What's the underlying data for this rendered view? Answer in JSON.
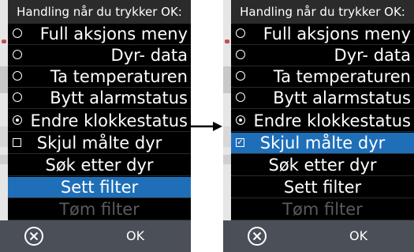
{
  "screens": [
    {
      "header": "Handling når du trykker OK:",
      "items": [
        {
          "label": "Full aksjons meny",
          "control": "radio",
          "checked": false
        },
        {
          "label": "Dyr- data",
          "control": "radio",
          "checked": false
        },
        {
          "label": "Ta temperaturen",
          "control": "radio",
          "checked": false
        },
        {
          "label": "Bytt alarmstatus",
          "control": "radio",
          "checked": false
        },
        {
          "label": "Endre klokkestatus",
          "control": "radio",
          "checked": true
        },
        {
          "label": "Skjul målte dyr",
          "control": "checkbox",
          "checked": false
        },
        {
          "label": "Søk etter dyr",
          "control": "none"
        },
        {
          "label": "Sett filter",
          "control": "none",
          "selected": true
        },
        {
          "label": "Tøm filter",
          "control": "none",
          "disabled": true
        }
      ],
      "footer": {
        "cancel_icon": "cancel-circle-x-icon",
        "ok_label": "OK"
      }
    },
    {
      "header": "Handling når du trykker OK:",
      "items": [
        {
          "label": "Full aksjons meny",
          "control": "radio",
          "checked": false
        },
        {
          "label": "Dyr- data",
          "control": "radio",
          "checked": false
        },
        {
          "label": "Ta temperaturen",
          "control": "radio",
          "checked": false
        },
        {
          "label": "Bytt alarmstatus",
          "control": "radio",
          "checked": false
        },
        {
          "label": "Endre klokkestatus",
          "control": "radio",
          "checked": true
        },
        {
          "label": "Skjul målte dyr",
          "control": "checkbox",
          "checked": true,
          "selected": true
        },
        {
          "label": "Søk etter dyr",
          "control": "none"
        },
        {
          "label": "Sett filter",
          "control": "none"
        },
        {
          "label": "Tøm filter",
          "control": "none",
          "disabled": true
        }
      ],
      "footer": {
        "cancel_icon": "cancel-circle-x-icon",
        "ok_label": "OK"
      }
    }
  ],
  "colors": {
    "selected": "#1f6fb8",
    "background": "#000000",
    "footer": "#4a4f58",
    "disabled_text": "#5a5a5a"
  },
  "transition_icon": "right-arrow-icon"
}
